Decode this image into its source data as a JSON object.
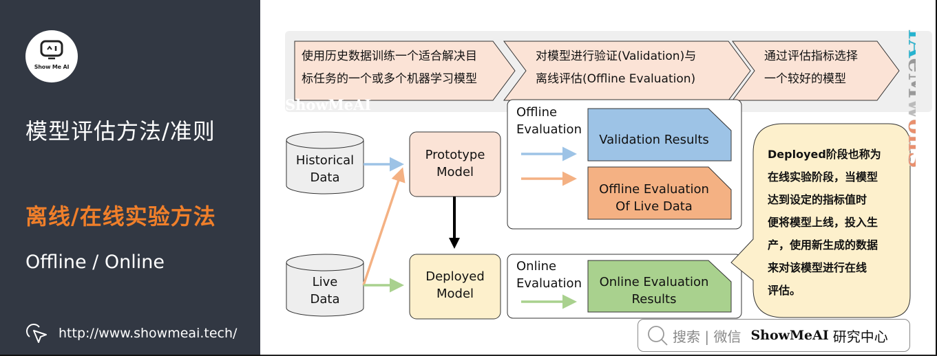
{
  "sidebar": {
    "logo_text": "Show Me AI",
    "title": "模型评估方法/准则",
    "subtitle": "离线/在线实验方法",
    "subtitle_en": "Offline / Online",
    "url": "http://www.showmeai.tech/",
    "accent_color": "#f07f2a",
    "background_color": "#323843"
  },
  "process_steps": [
    {
      "line1": "使用历史数据训练一个适合解决目",
      "line2": "标任务的一个或多个机器学习模型"
    },
    {
      "line1": "对模型进行验证(Validation)与",
      "line2": "离线评估(Offline Evaluation)"
    },
    {
      "line1": "通过评估指标选择",
      "line2": "一个较好的模型"
    }
  ],
  "diagram": {
    "data_sources": [
      {
        "line1": "Historical",
        "line2": "Data"
      },
      {
        "line1": "Live",
        "line2": "Data"
      }
    ],
    "models": [
      {
        "line1": "Prototype",
        "line2": "Model",
        "color": "#fbe3d6"
      },
      {
        "line1": "Deployed",
        "line2": "Model",
        "color": "#fdf0cc"
      }
    ],
    "offline_eval": {
      "label_line1": "Offline",
      "label_line2": "Evaluation",
      "results": [
        {
          "line1": "Validation Results",
          "line2": "",
          "color": "#9dc3e6"
        },
        {
          "line1": "Offline Evaluation",
          "line2": "Of Live Data",
          "color": "#f4b183"
        }
      ]
    },
    "online_eval": {
      "label_line1": "Online",
      "label_line2": "Evaluation",
      "results": [
        {
          "line1": "Online Evaluation",
          "line2": "Results",
          "color": "#a9d18e"
        }
      ]
    },
    "arrow_colors": {
      "blue": "#9dc3e6",
      "orange": "#f4b183",
      "green": "#a9d18e",
      "black": "#000000"
    }
  },
  "callout": {
    "lines": [
      "Deployed阶段也称为",
      "在线实验阶段，当模型",
      "达到设定的指标值时",
      "便将模型上线，投入生",
      "产，使用新生成的数据",
      "来对该模型进行在线",
      "评估。"
    ]
  },
  "watermarks": {
    "top": "ShowMeAI",
    "side": "ShowMeAI"
  },
  "search_bar": {
    "hint": "搜索 | 微信",
    "brand": "ShowMeAI",
    "suffix": "研究中心"
  }
}
